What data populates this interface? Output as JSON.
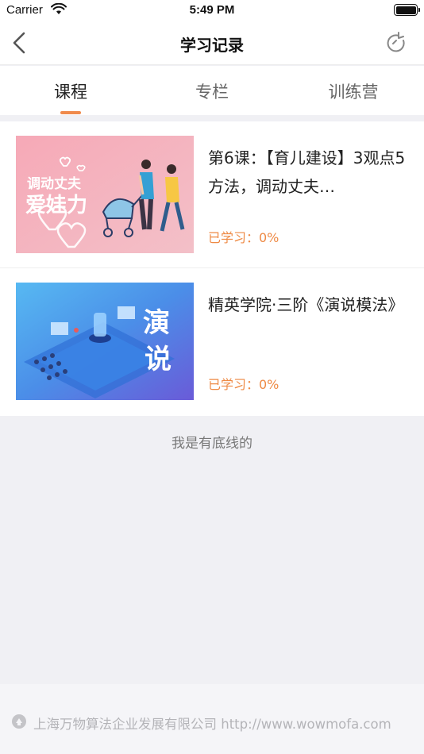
{
  "status_bar": {
    "carrier": "Carrier",
    "time": "5:49 PM"
  },
  "nav": {
    "title": "学习记录"
  },
  "tabs": [
    {
      "label": "课程",
      "active": true
    },
    {
      "label": "专栏",
      "active": false
    },
    {
      "label": "训练营",
      "active": false
    }
  ],
  "courses": [
    {
      "title": "第6课：【育儿建设】3观点5方法，调动丈夫…",
      "progress": "已学习：0%",
      "thumb_text_1": "调动丈夫",
      "thumb_text_2": "爱娃力"
    },
    {
      "title": "精英学院·三阶《演说模法》",
      "progress": "已学习：0%",
      "thumb_text_1": "演",
      "thumb_text_2": "说"
    }
  ],
  "footer_note": "我是有底线的",
  "copyright": "上海万物算法企业发展有限公司 http://www.wowmofa.com",
  "colors": {
    "accent": "#f08a4b",
    "progress": "#ee8a45",
    "background": "#f0f0f4"
  }
}
